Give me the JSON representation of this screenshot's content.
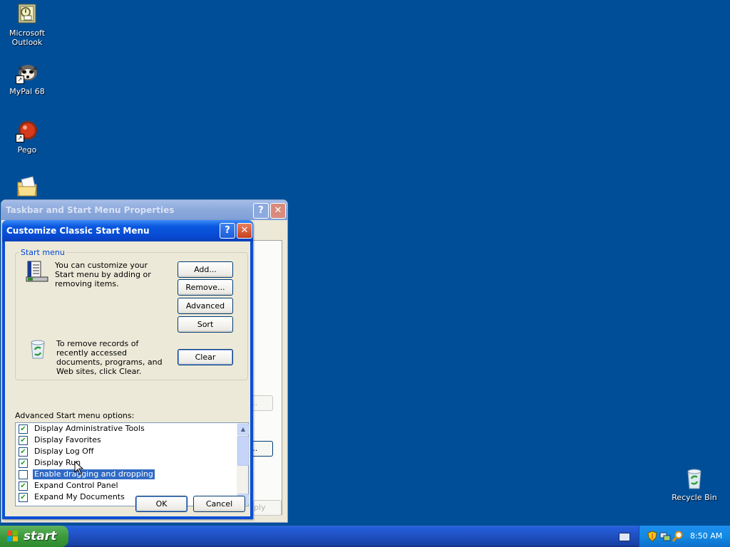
{
  "desktop": {
    "icons": [
      {
        "label": "Microsoft Outlook",
        "icon": "outlook-icon"
      },
      {
        "label": "MyPal 68",
        "icon": "mypal-icon"
      },
      {
        "label": "Pego",
        "icon": "pego-icon"
      },
      {
        "label": "",
        "icon": "folder-envelope-icon"
      },
      {
        "label": "Recycle Bin",
        "icon": "recycle-bin-icon"
      }
    ]
  },
  "back_window": {
    "title": "Taskbar and Start Menu Properties",
    "ghost_buttons": [
      "e...",
      "e...",
      "ply"
    ]
  },
  "dialog": {
    "title": "Customize Classic Start Menu",
    "group_label": "Start menu",
    "customize_text": "You can customize your Start menu by adding or removing items.",
    "clear_text": "To remove records of recently accessed documents, programs, and Web sites, click Clear.",
    "buttons": {
      "add": "Add...",
      "remove": "Remove...",
      "advanced": "Advanced",
      "sort": "Sort",
      "clear": "Clear",
      "ok": "OK",
      "cancel": "Cancel"
    },
    "advanced_label": "Advanced Start menu options:",
    "options": [
      {
        "label": "Display Administrative Tools",
        "checked": true,
        "selected": false
      },
      {
        "label": "Display Favorites",
        "checked": true,
        "selected": false
      },
      {
        "label": "Display Log Off",
        "checked": true,
        "selected": false
      },
      {
        "label": "Display Run",
        "checked": true,
        "selected": false
      },
      {
        "label": "Enable dragging and dropping",
        "checked": false,
        "selected": true
      },
      {
        "label": "Expand Control Panel",
        "checked": true,
        "selected": false
      },
      {
        "label": "Expand My Documents",
        "checked": true,
        "selected": false
      }
    ]
  },
  "taskbar": {
    "start_label": "start",
    "clock": "8:50 AM"
  },
  "colors": {
    "desktop": "#004e98",
    "title_active": "#0a58e0",
    "title_inactive": "#8ca9dc",
    "dialog_face": "#ece9d8",
    "selection": "#316ac5",
    "checkmark": "#21a121"
  }
}
